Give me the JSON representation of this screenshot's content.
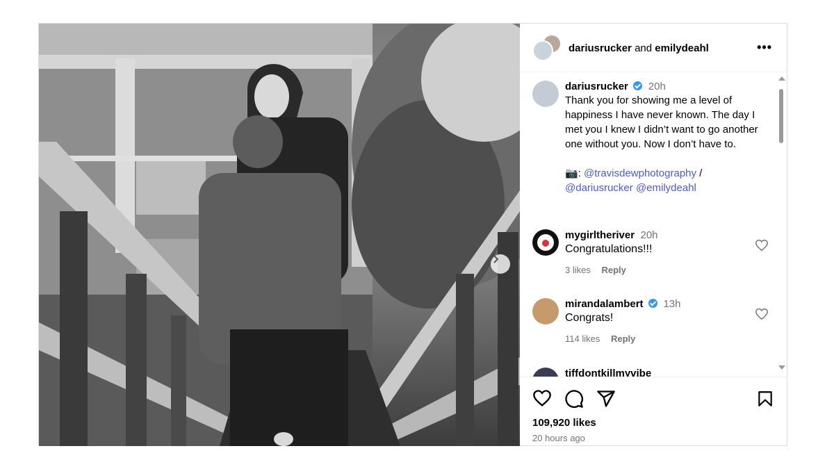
{
  "post": {
    "image_alt": "man kneeling proposing to woman on wooden boardwalk, black and white photo",
    "header": {
      "user1": "dariusrucker",
      "conjunction": "and",
      "user2": "emilydeahl",
      "more_icon": "more-horizontal-icon"
    },
    "caption": {
      "username": "dariusrucker",
      "verified": true,
      "time": "20h",
      "text": "Thank you for showing me a level of happiness I have never known. The day I met you I knew I didn’t want to go another one without you. Now I don’t have to.",
      "camera_emoji": "📷",
      "credit_sep": ": ",
      "credit_link1": "@travisdewphotography",
      "credit_slash": " /",
      "credit_link2": "@dariusrucker",
      "credit_link3": "@emilydeahl"
    },
    "comments": [
      {
        "username": "mygirltheriver",
        "verified": false,
        "time": "20h",
        "text": "Congratulations!!!",
        "likes": "3 likes",
        "reply": "Reply"
      },
      {
        "username": "mirandalambert",
        "verified": true,
        "time": "13h",
        "text": "Congrats!",
        "likes": "114 likes",
        "reply": "Reply"
      },
      {
        "username": "tiffdontkillmyvibe",
        "verified": false,
        "time": "",
        "text": "",
        "likes": "",
        "reply": ""
      }
    ],
    "actions": {
      "like_icon": "heart-icon",
      "comment_icon": "comment-icon",
      "share_icon": "share-icon",
      "save_icon": "bookmark-icon"
    },
    "likes_count": "109,920 likes",
    "posted_ago": "20 hours ago"
  }
}
